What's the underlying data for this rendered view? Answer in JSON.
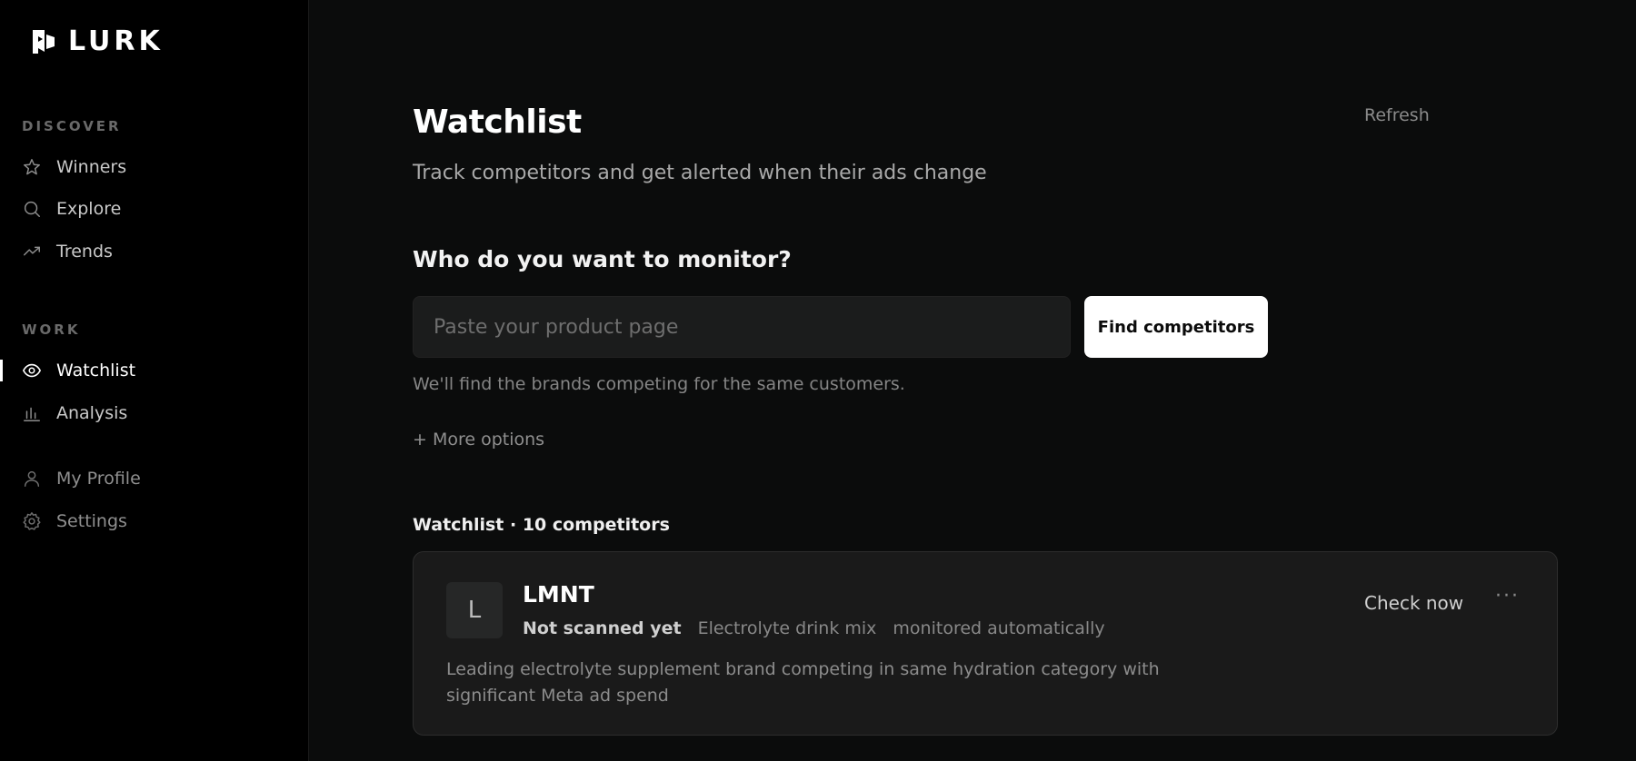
{
  "app": {
    "name": "LURK"
  },
  "sidebar": {
    "sections": [
      {
        "label": "DISCOVER"
      },
      {
        "label": "WORK"
      }
    ],
    "items": [
      {
        "label": "Winners",
        "icon": "star-icon"
      },
      {
        "label": "Explore",
        "icon": "search-icon"
      },
      {
        "label": "Trends",
        "icon": "trend-icon"
      },
      {
        "label": "Watchlist",
        "icon": "eye-icon",
        "active": true
      },
      {
        "label": "Analysis",
        "icon": "bar-chart-icon"
      },
      {
        "label": "My Profile",
        "icon": "user-icon"
      },
      {
        "label": "Settings",
        "icon": "gear-icon"
      }
    ]
  },
  "header": {
    "title": "Watchlist",
    "subtitle": "Track competitors and get alerted when their ads change",
    "refresh_label": "Refresh"
  },
  "monitor": {
    "question": "Who do you want to monitor?",
    "input_placeholder": "Paste your product page",
    "input_value": "",
    "button_label": "Find competitors",
    "hint": "We'll find the brands competing for the same customers.",
    "more_options_label": "+ More options"
  },
  "watchlist": {
    "heading": "Watchlist · 10 competitors",
    "items": [
      {
        "initial": "L",
        "name": "LMNT",
        "status": "Not scanned yet",
        "category": "Electrolyte drink mix",
        "mode": "monitored automatically",
        "description": "Leading electrolyte supplement brand competing in same hydration category with significant Meta ad spend",
        "check_label": "Check now",
        "menu_label": "···"
      }
    ]
  },
  "colors": {
    "sidebar_bg": "#000000",
    "main_bg": "#0b0c0c",
    "card_bg": "#1a1a1a",
    "primary_button": "#ffffff"
  }
}
